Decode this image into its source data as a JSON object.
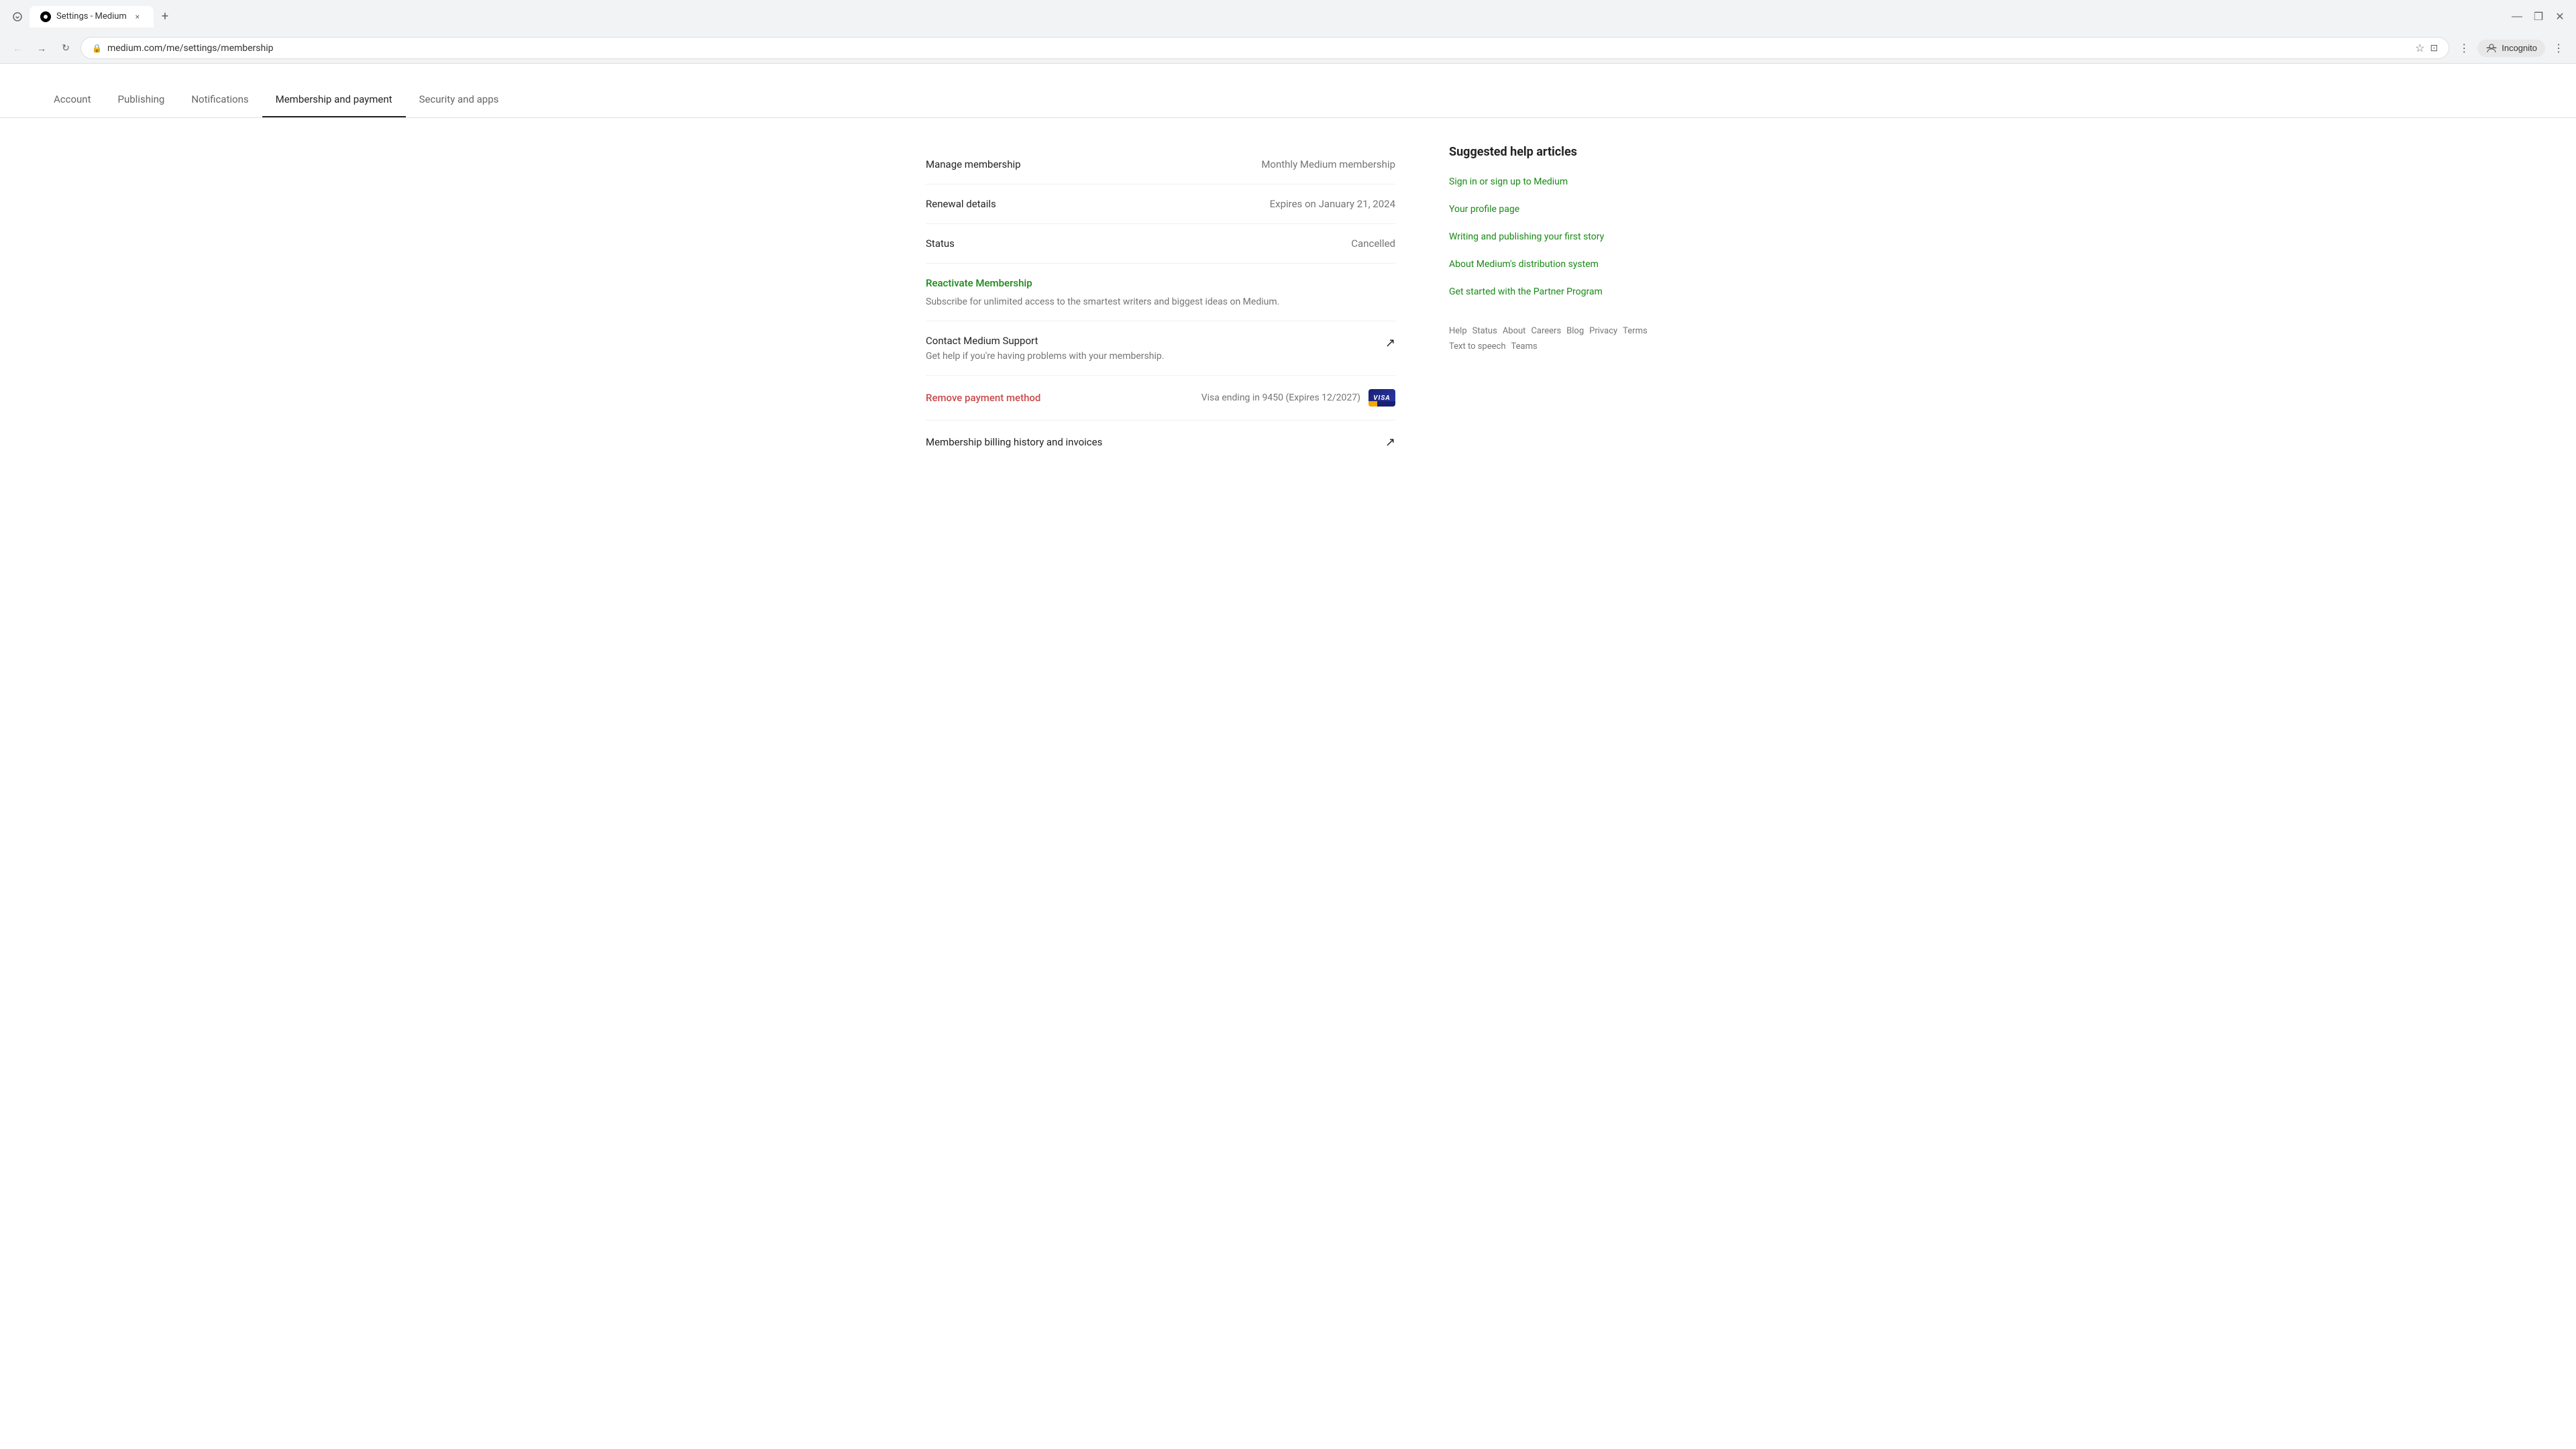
{
  "browser": {
    "tab_title": "Settings - Medium",
    "url": "medium.com/me/settings/membership",
    "new_tab_label": "+",
    "close_label": "×",
    "back_label": "←",
    "forward_label": "→",
    "reload_label": "↻",
    "incognito_label": "Incognito",
    "minimize_label": "—",
    "maximize_label": "❐",
    "window_close_label": "✕"
  },
  "nav": {
    "tabs": [
      {
        "id": "account",
        "label": "Account",
        "active": false
      },
      {
        "id": "publishing",
        "label": "Publishing",
        "active": false
      },
      {
        "id": "notifications",
        "label": "Notifications",
        "active": false
      },
      {
        "id": "membership",
        "label": "Membership and payment",
        "active": true
      },
      {
        "id": "security",
        "label": "Security and apps",
        "active": false
      }
    ]
  },
  "main": {
    "manage_membership_label": "Manage membership",
    "manage_membership_value": "Monthly Medium membership",
    "renewal_label": "Renewal details",
    "renewal_value": "Expires on January 21, 2024",
    "status_label": "Status",
    "status_value": "Cancelled",
    "reactivate_label": "Reactivate Membership",
    "reactivate_subtitle": "Subscribe for unlimited access to the smartest writers and biggest ideas on Medium.",
    "contact_support_title": "Contact Medium Support",
    "contact_support_subtitle": "Get help if you're having problems with your membership.",
    "contact_external_icon": "↗",
    "remove_payment_label": "Remove payment method",
    "payment_info_text": "Visa ending in 9450 (Expires 12/2027)",
    "visa_label": "VISA",
    "billing_history_label": "Membership billing history and invoices",
    "billing_external_icon": "↗"
  },
  "sidebar": {
    "title": "Suggested help articles",
    "links": [
      {
        "id": "sign-in",
        "label": "Sign in or sign up to Medium"
      },
      {
        "id": "profile",
        "label": "Your profile page"
      },
      {
        "id": "writing",
        "label": "Writing and publishing your first story"
      },
      {
        "id": "distribution",
        "label": "About Medium's distribution system"
      },
      {
        "id": "partner",
        "label": "Get started with the Partner Program"
      }
    ]
  },
  "footer": {
    "links": [
      {
        "id": "help",
        "label": "Help"
      },
      {
        "id": "status",
        "label": "Status"
      },
      {
        "id": "about",
        "label": "About"
      },
      {
        "id": "careers",
        "label": "Careers"
      },
      {
        "id": "blog",
        "label": "Blog"
      },
      {
        "id": "privacy",
        "label": "Privacy"
      },
      {
        "id": "terms",
        "label": "Terms"
      },
      {
        "id": "text-to-speech",
        "label": "Text to speech"
      },
      {
        "id": "teams",
        "label": "Teams"
      }
    ]
  }
}
